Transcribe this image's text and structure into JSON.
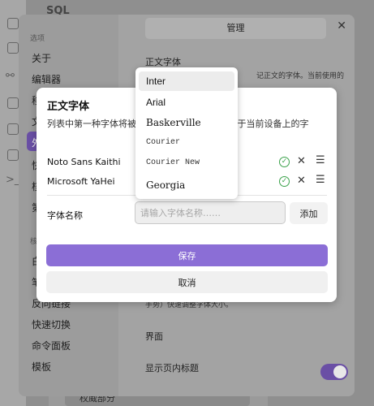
{
  "app": {
    "title": "SQL",
    "tree": {
      "parent": "笔记",
      "selected": "权威部分"
    }
  },
  "settings": {
    "nav": {
      "section_options": "选项",
      "items": [
        "关于",
        "编辑器",
        "移",
        "文",
        "外",
        "快",
        "核",
        "第"
      ],
      "active_index": 4,
      "section_plugins": "核",
      "plugins": [
        "白",
        "笔",
        "反向链接",
        "快速切换",
        "命令面板",
        "模板"
      ]
    },
    "manage_label": "管理",
    "section_font_title": "正文字体",
    "section_font_desc": "记正文的字体。当前使用的",
    "zoom_desc": "手势）快速调整字体大小。",
    "section_interface": "界面",
    "show_inline_title": "显示页内标题"
  },
  "modal": {
    "title": "正文字体",
    "description": "列表中第一种字体将被                    前设备上，则顺延至存在于当前设备上的字",
    "fonts": [
      {
        "name": "Noto Sans Kaithi"
      },
      {
        "name": "Microsoft YaHei"
      }
    ],
    "field_label": "字体名称",
    "input_placeholder": "请输入字体名称……",
    "add_label": "添加",
    "save_label": "保存",
    "cancel_label": "取消"
  },
  "dropdown": {
    "options": [
      "Inter",
      "Arial",
      "Baskerville",
      "Courier",
      "Courier New",
      "Georgia"
    ],
    "highlighted_index": 0
  },
  "colors": {
    "accent": "#8b6ed6",
    "check": "#3aa14a"
  }
}
